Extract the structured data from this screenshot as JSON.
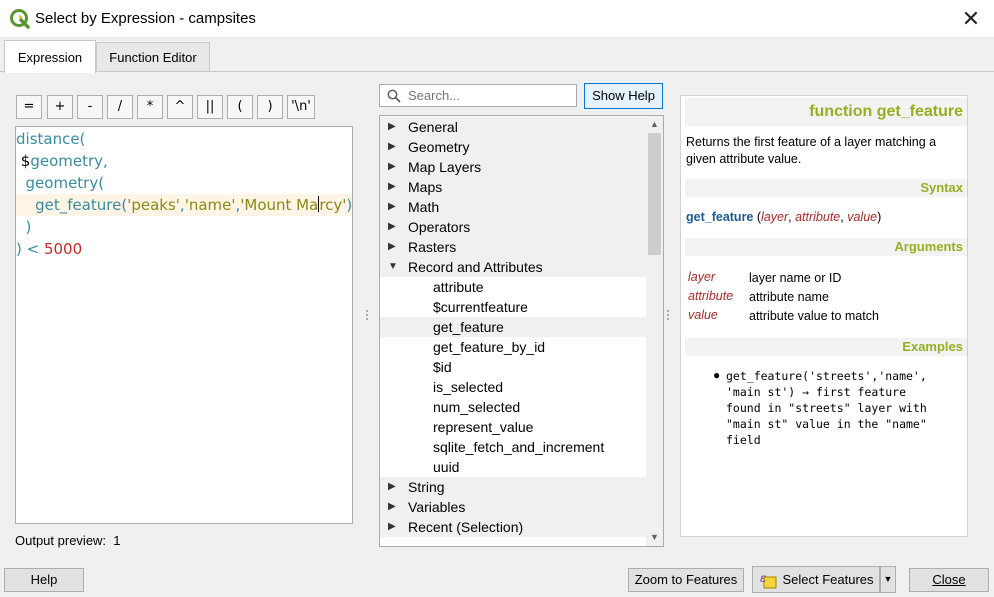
{
  "window": {
    "title": "Select by Expression - campsites",
    "close_glyph": "✕"
  },
  "tabs": [
    {
      "label": "Expression",
      "active": true
    },
    {
      "label": "Function Editor",
      "active": false
    }
  ],
  "operators": [
    "=",
    "+",
    "-",
    "/",
    "*",
    "^",
    "||",
    "(",
    ")",
    "'\\n'"
  ],
  "editor": {
    "lines": [
      [
        {
          "t": "distance(",
          "c": "fn"
        }
      ],
      [
        {
          "t": " ",
          "c": "plain"
        },
        {
          "t": "$",
          "c": "plain"
        },
        {
          "t": "geometry,",
          "c": "fn"
        }
      ],
      [
        {
          "t": "  geometry(",
          "c": "fn"
        }
      ],
      [
        {
          "t": "    get_feature(",
          "c": "fn"
        },
        {
          "t": "'peaks'",
          "c": "str"
        },
        {
          "t": ",",
          "c": "fn"
        },
        {
          "t": "'name'",
          "c": "str"
        },
        {
          "t": ",",
          "c": "fn"
        },
        {
          "t": "'Mount Ma",
          "c": "str"
        },
        {
          "t": "|",
          "c": "caret"
        },
        {
          "t": "rcy'",
          "c": "str"
        },
        {
          "t": ")",
          "c": "fn"
        }
      ],
      [
        {
          "t": "  )",
          "c": "fn"
        }
      ],
      [
        {
          "t": ") < ",
          "c": "fn"
        },
        {
          "t": "5000",
          "c": "num"
        }
      ]
    ],
    "highlighted_line": 3
  },
  "output_preview": {
    "label": "Output preview:",
    "value": "1"
  },
  "search": {
    "placeholder": "Search..."
  },
  "show_help_label": "Show Help",
  "tree": {
    "groups_top": [
      "General",
      "Geometry",
      "Map Layers",
      "Maps",
      "Math",
      "Operators",
      "Rasters"
    ],
    "expanded_group": "Record and Attributes",
    "children": [
      "attribute",
      "$currentfeature",
      "get_feature",
      "get_feature_by_id",
      "$id",
      "is_selected",
      "num_selected",
      "represent_value",
      "sqlite_fetch_and_increment",
      "uuid"
    ],
    "selected_child": "get_feature",
    "groups_bottom": [
      "String",
      "Variables",
      "Recent (Selection)"
    ]
  },
  "help": {
    "heading": "function get_feature",
    "description_1": "Returns the first feature of a layer matching a",
    "description_2": "given attribute value.",
    "syntax_heading": "Syntax",
    "syntax_fn": "get_feature",
    "syntax_args": [
      "layer",
      "attribute",
      "value"
    ],
    "arguments_heading": "Arguments",
    "arguments": [
      {
        "name": "layer",
        "desc": "layer name or ID"
      },
      {
        "name": "attribute",
        "desc": "attribute name"
      },
      {
        "name": "value",
        "desc": "attribute value to match"
      }
    ],
    "examples_heading": "Examples",
    "example_lines": [
      "get_feature('streets','name',",
      "'main st') → first feature",
      "found in \"streets\" layer with",
      "\"main st\" value in the \"name\"",
      "field"
    ]
  },
  "footer": {
    "help_label": "Help",
    "zoom_label": "Zoom to Features",
    "select_label": "Select Features",
    "close_label": "Close"
  },
  "colors": {
    "function": "#3b8ba0",
    "string": "#8a8a14",
    "number": "#c62828",
    "help_heading": "#93b023",
    "arg_name": "#a52a2a",
    "accent_border": "#0078d7"
  }
}
